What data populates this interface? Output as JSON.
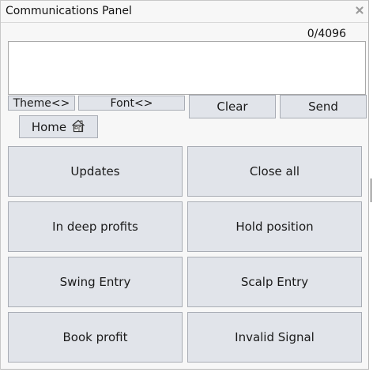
{
  "panel": {
    "title": "Communications Panel",
    "counter": "0/4096",
    "message_placeholder": ""
  },
  "toolbar": {
    "theme_label": "Theme<>",
    "font_label": "Font<>",
    "clear_label": "Clear",
    "send_label": "Send",
    "home_label": "Home"
  },
  "actions": [
    {
      "label": "Updates"
    },
    {
      "label": "Close all"
    },
    {
      "label": "In deep profits"
    },
    {
      "label": "Hold position"
    },
    {
      "label": "Swing Entry"
    },
    {
      "label": "Scalp Entry"
    },
    {
      "label": "Book profit"
    },
    {
      "label": "Invalid Signal"
    }
  ],
  "icons": {
    "close": "close-icon",
    "home": "home-icon"
  }
}
